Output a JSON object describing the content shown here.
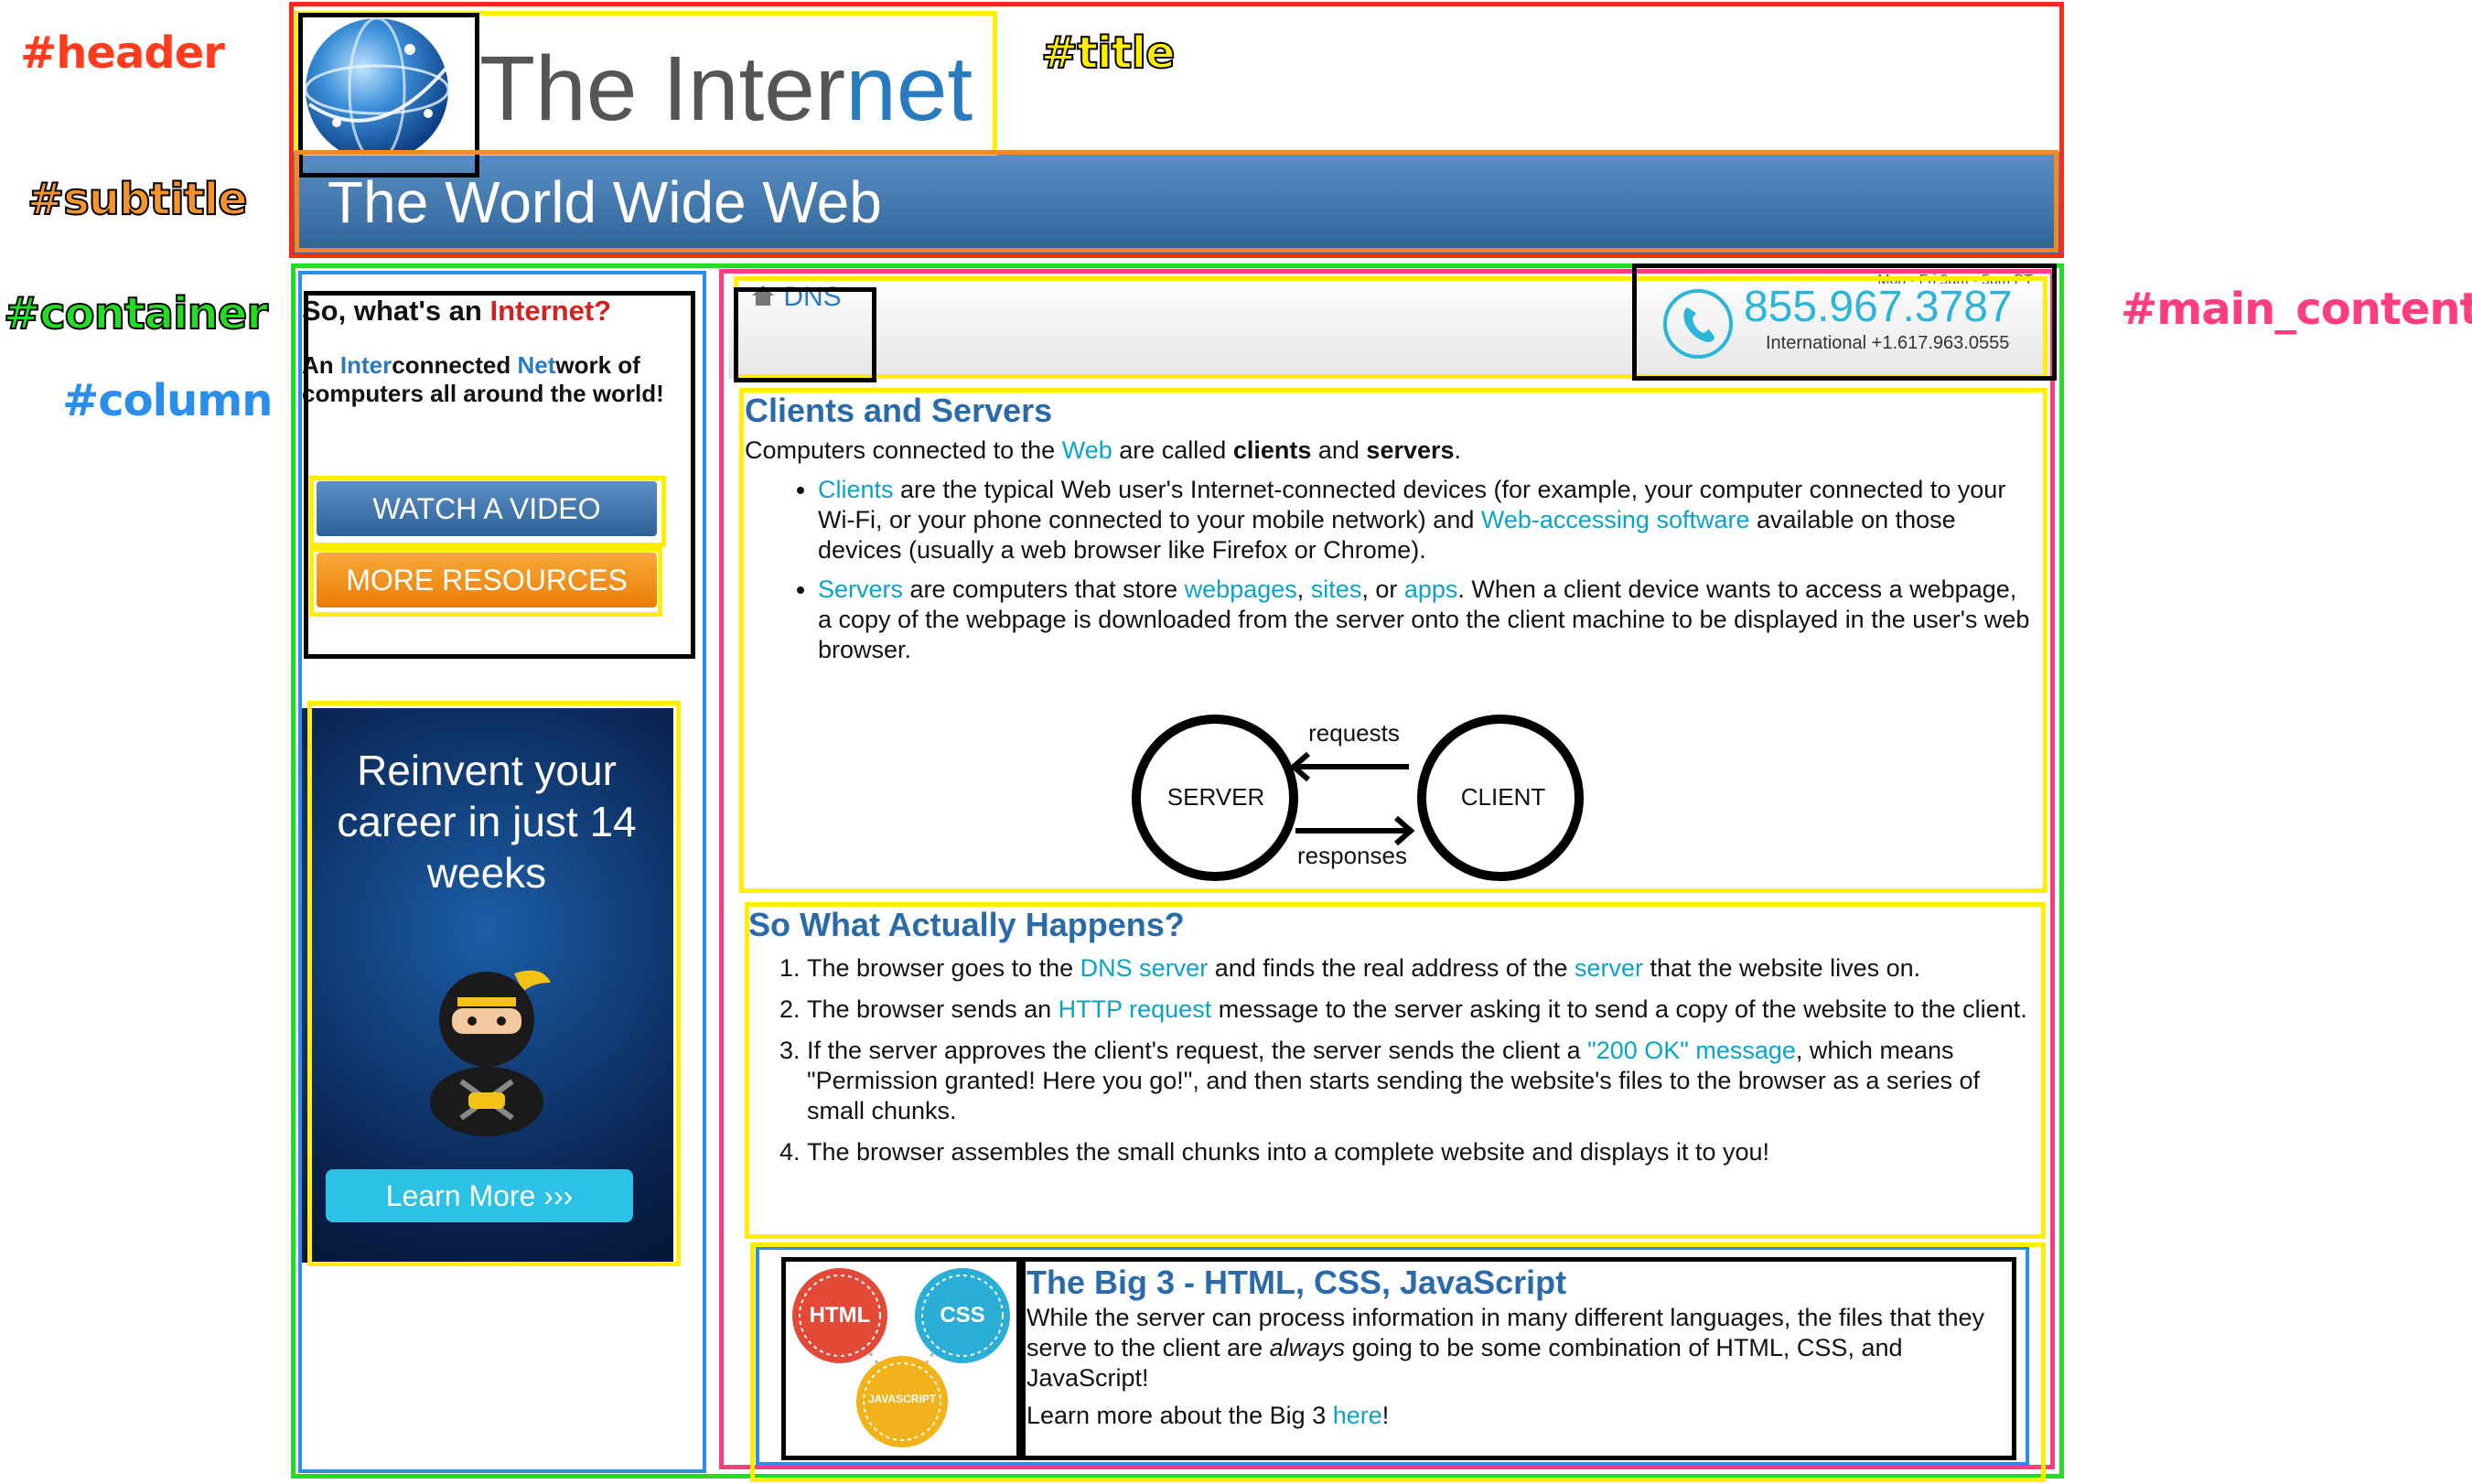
{
  "annotations": {
    "header": "#header",
    "title": "#title",
    "subtitle": "#subtitle",
    "container": "#container",
    "column": "#column",
    "main_content": "#main_content"
  },
  "header": {
    "title_plain": "The Inter",
    "title_accent": "net",
    "subtitle": "The World Wide Web"
  },
  "sidebar": {
    "question_prefix": "So, what's an ",
    "question_accent": "Internet?",
    "def_1": "An ",
    "def_inter": "Inter",
    "def_2": "connected ",
    "def_net": "Net",
    "def_3": "work of computers all around the world!",
    "watch_video": "WATCH A VIDEO",
    "more_resources": "MORE RESOURCES"
  },
  "ad": {
    "headline": "Reinvent your career in just 14 weeks",
    "cta": "Learn More ›››"
  },
  "breadcrumb": {
    "label": "DNS"
  },
  "phone": {
    "top": "Mon - Fri 9am - 5pm PT",
    "number": "855.967.3787",
    "intl": "International +1.617.963.0555"
  },
  "section1": {
    "title": "Clients and Servers",
    "intro_1": "Computers connected to the ",
    "intro_web": "Web",
    "intro_2": " are called ",
    "intro_clients": "clients",
    "intro_3": " and ",
    "intro_servers": "servers",
    "intro_4": ".",
    "b1_link": "Clients",
    "b1_1": " are the typical Web user's Internet-connected devices (for example, your computer connected to your Wi-Fi, or your phone connected to your mobile network) and ",
    "b1_link2": "Web-accessing software",
    "b1_2": " available on those devices (usually a web browser like Firefox or Chrome).",
    "b2_link": "Servers",
    "b2_1": " are computers that store ",
    "b2_l_webpages": "webpages",
    "b2_c1": ", ",
    "b2_l_sites": "sites",
    "b2_c2": ", or ",
    "b2_l_apps": "apps",
    "b2_2": ". When a client device wants to access a webpage, a copy of the webpage is downloaded from the server onto the client machine to be displayed in the user's web browser.",
    "diagram": {
      "server": "SERVER",
      "client": "CLIENT",
      "requests": "requests",
      "responses": "responses"
    }
  },
  "section2": {
    "title": "So What Actually Happens?",
    "s1_1": "The browser goes to the ",
    "s1_l1": "DNS server",
    "s1_2": " and finds the real address of the ",
    "s1_l2": "server",
    "s1_3": " that the website lives on.",
    "s2_1": "The browser sends an ",
    "s2_l1": "HTTP request",
    "s2_2": " message to the server asking it to send a copy of the website to the client.",
    "s3_1": "If the server approves the client's request, the server sends the client a ",
    "s3_l1": "\"200 OK\" message",
    "s3_2": ", which means \"Permission granted! Here you go!\", and then starts sending the website's files to the browser as a series of small chunks.",
    "s4": "The browser assembles the small chunks into a complete website and displays it to you!"
  },
  "big3": {
    "badge_html": "HTML",
    "badge_css": "CSS",
    "badge_js": "JAVASCRIPT",
    "title": "The Big 3 - HTML, CSS, JavaScript",
    "p1_1": "While the server can process information in many different languages, the files that they serve to the client are ",
    "p1_em": "always",
    "p1_2": " going to be some combination of HTML, CSS, and JavaScript!",
    "p2_1": "Learn more about the Big 3 ",
    "p2_link": "here",
    "p2_2": "!"
  },
  "colors": {
    "header_bar": "#3a6fa3",
    "orange_btn": "#f3941e",
    "blue_btn": "#3b6fa6",
    "link": "#0aa3c8",
    "heading": "#2a6aa8",
    "ad_bg": "#0b2a55",
    "cta": "#2bc2e6"
  }
}
